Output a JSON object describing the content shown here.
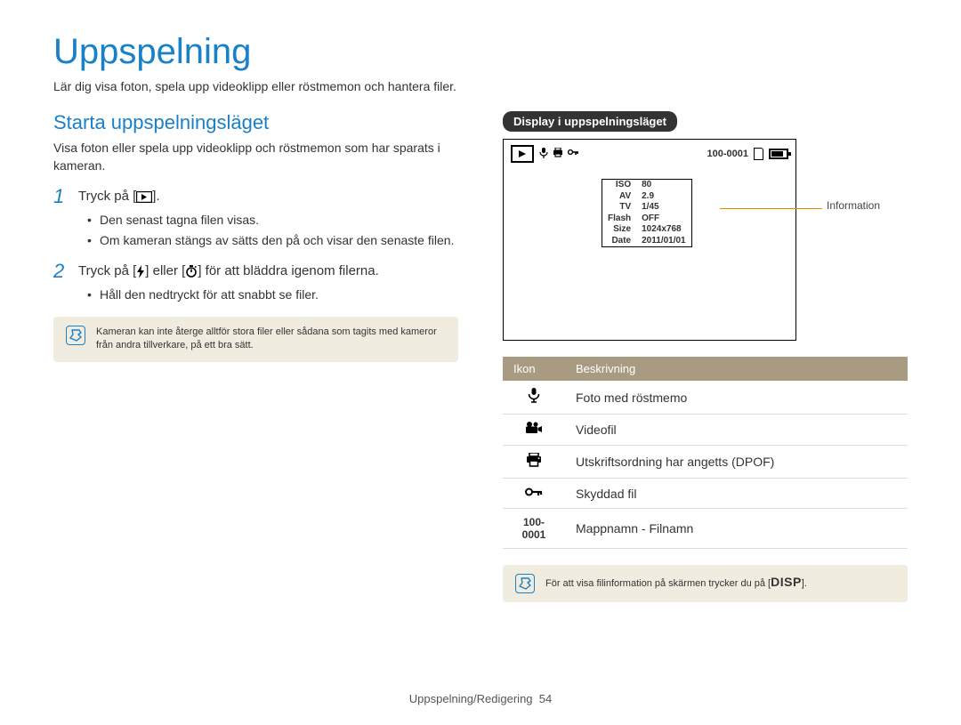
{
  "page_title": "Uppspelning",
  "intro_text": "Lär dig visa foton, spela upp videoklipp eller röstmemon och hantera filer.",
  "left": {
    "heading": "Starta uppspelningsläget",
    "paragraph": "Visa foton eller spela upp videoklipp och röstmemon som har sparats i kameran.",
    "step1_pre": "Tryck på [",
    "step1_post": "].",
    "step1_bullets": [
      "Den senast tagna filen visas.",
      "Om kameran stängs av sätts den på och visar den senaste filen."
    ],
    "step2_pre": "Tryck på [",
    "step2_mid": "] eller [",
    "step2_post": "] för att bläddra igenom filerna.",
    "step2_bullets": [
      "Håll den nedtryckt för att snabbt se filer."
    ],
    "note": "Kameran kan inte återge alltför stora filer eller sådana som tagits med kameror från andra tillverkare, på ett bra sätt."
  },
  "right": {
    "pill": "Display i uppspelningsläget",
    "display": {
      "file_index": "100-0001",
      "info": {
        "labels": [
          "ISO",
          "AV",
          "TV",
          "Flash",
          "Size",
          "Date"
        ],
        "values": [
          "80",
          "2.9",
          "1/45",
          "OFF",
          "1024x768",
          "2011/01/01"
        ]
      }
    },
    "callout": "Information",
    "table": {
      "head_icon": "Ikon",
      "head_desc": "Beskrivning",
      "rows": [
        {
          "icon": "microphone-icon",
          "desc": "Foto med röstmemo"
        },
        {
          "icon": "movie-camera-icon",
          "desc": "Videofil"
        },
        {
          "icon": "printer-icon",
          "desc": "Utskriftsordning har angetts (DPOF)"
        },
        {
          "icon": "key-icon",
          "desc": "Skyddad fil"
        },
        {
          "icon": "file-index",
          "desc": "Mappnamn - Filnamn"
        }
      ],
      "file_index_label": "100-0001"
    },
    "note_pre": "För att visa filinformation på skärmen trycker du på [",
    "note_key": "DISP",
    "note_post": "]."
  },
  "footer": {
    "section": "Uppspelning/Redigering",
    "page_number": "54"
  }
}
